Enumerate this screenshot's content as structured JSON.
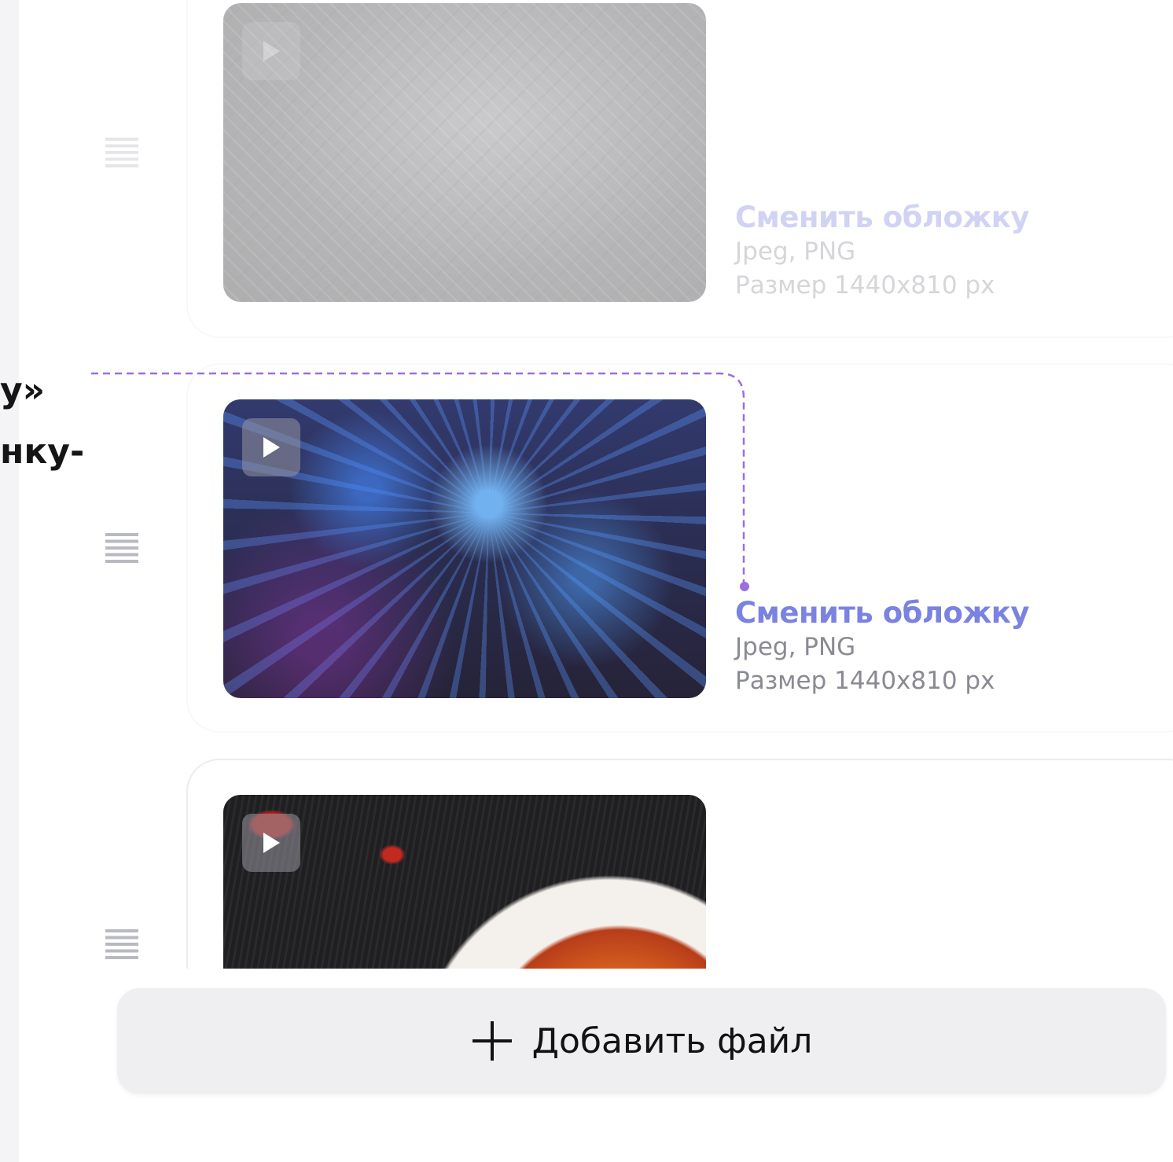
{
  "annotation": {
    "line1": "у»",
    "line2": "нку-"
  },
  "items": [
    {
      "thumb": "circuit-board-image",
      "has_play_icon": true,
      "change_label": "Сменить обложку",
      "formats": "Jpeg, PNG",
      "size": "Размер 1440x810 px"
    },
    {
      "thumb": "fiber-optic-image",
      "has_play_icon": true,
      "change_label": "Сменить обложку",
      "formats": "Jpeg, PNG",
      "size": "Размер 1440x810 px"
    },
    {
      "thumb": "food-bowl-image",
      "has_play_icon": true
    }
  ],
  "add_button": {
    "label": "Добавить файл",
    "icon": "plus-icon"
  },
  "colors": {
    "accent": "#7a83e0",
    "connector": "#9b6fe0",
    "meta_text": "#8a8a96",
    "button_bg": "#efeff1"
  }
}
